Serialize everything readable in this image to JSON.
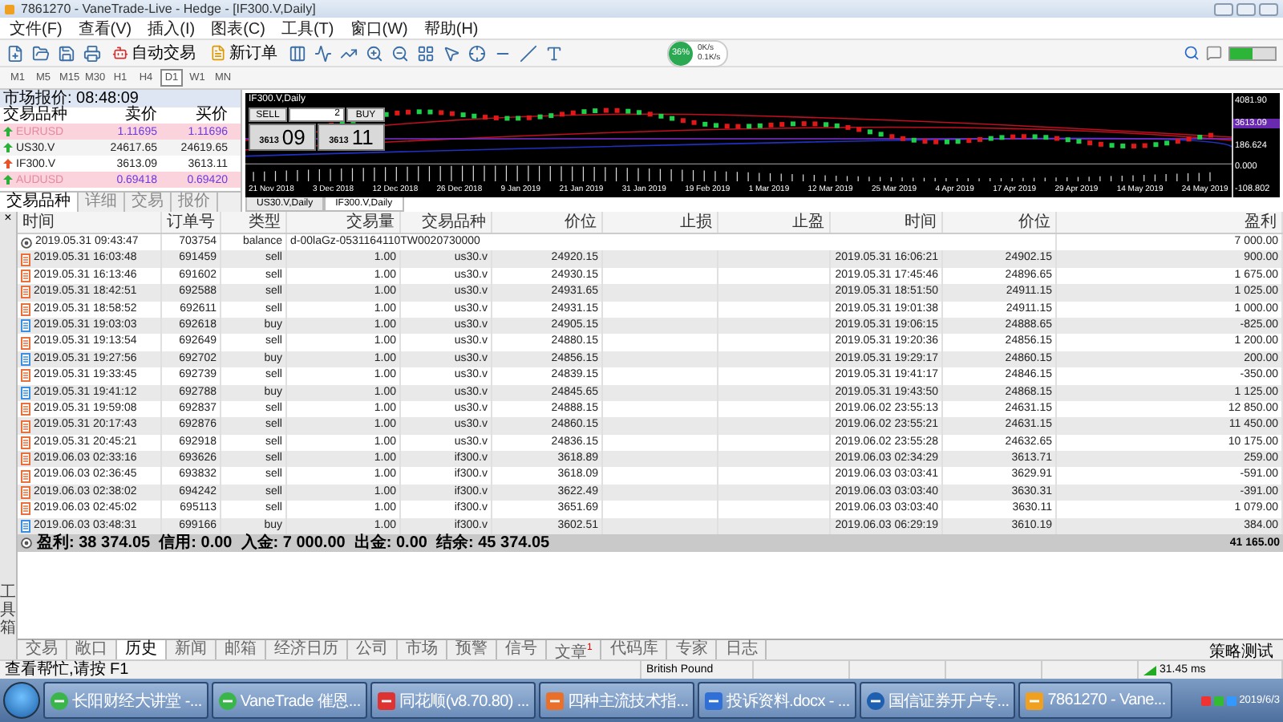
{
  "window": {
    "title": "7861270 - VaneTrade-Live - Hedge - [IF300.V,Daily]"
  },
  "menu": [
    "文件(F)",
    "查看(V)",
    "插入(I)",
    "图表(C)",
    "工具(T)",
    "窗口(W)",
    "帮助(H)"
  ],
  "toolbar": {
    "buttons": [
      "自动交易",
      "新订单"
    ],
    "network": {
      "percent": "36%",
      "upload": "0K/s",
      "download": "0.1K/s"
    }
  },
  "timeframes": [
    {
      "label": "M1",
      "selected": false
    },
    {
      "label": "M5",
      "selected": false
    },
    {
      "label": "M15",
      "selected": false
    },
    {
      "label": "M30",
      "selected": false
    },
    {
      "label": "H1",
      "selected": false
    },
    {
      "label": "H4",
      "selected": false
    },
    {
      "label": "D1",
      "selected": true
    },
    {
      "label": "W1",
      "selected": false
    },
    {
      "label": "MN",
      "selected": false
    }
  ],
  "market_watch": {
    "title": "市场报价: 08:48:09",
    "columns": [
      "交易品种",
      "卖价",
      "买价"
    ],
    "rows": [
      {
        "symbol": "EURUSD",
        "bid": "1.11695",
        "ask": "1.11696",
        "highlighted": true,
        "rising": true
      },
      {
        "symbol": "US30.V",
        "bid": "24617.65",
        "ask": "24619.65",
        "highlighted": false,
        "rising": true
      },
      {
        "symbol": "IF300.V",
        "bid": "3613.09",
        "ask": "3613.11",
        "highlighted": false,
        "rising": false
      },
      {
        "symbol": "AUDUSD",
        "bid": "0.69418",
        "ask": "0.69420",
        "highlighted": true,
        "rising": true
      }
    ],
    "tabs": [
      {
        "label": "交易品种",
        "selected": true
      },
      {
        "label": "详细",
        "selected": false
      },
      {
        "label": "交易",
        "selected": false
      },
      {
        "label": "报价",
        "selected": false
      }
    ]
  },
  "chart": {
    "title": "IF300.V,Daily",
    "sell": "SELL",
    "buy": "BUY",
    "lots": "2",
    "bid_small": "3613",
    "bid_big": "09",
    "ask_small": "3613",
    "ask_big": "11",
    "price_labels": [
      "4081.90",
      "3613.09",
      "186.624",
      "0.000",
      "-108.802"
    ],
    "dates": [
      "21 Nov 2018",
      "3 Dec 2018",
      "12 Dec 2018",
      "26 Dec 2018",
      "9 Jan 2019",
      "21 Jan 2019",
      "31 Jan 2019",
      "19 Feb 2019",
      "1 Mar 2019",
      "12 Mar 2019",
      "25 Mar 2019",
      "4 Apr 2019",
      "17 Apr 2019",
      "29 Apr 2019",
      "14 May 2019",
      "24 May 2019"
    ],
    "tabs": [
      {
        "label": "US30.V,Daily",
        "selected": false
      },
      {
        "label": "IF300.V,Daily",
        "selected": true
      }
    ]
  },
  "history": {
    "columns": [
      "时间",
      "订单号",
      "类型",
      "交易量",
      "交易品种",
      "价位",
      "止损",
      "止盈",
      "时间",
      "价位",
      "盈利"
    ],
    "rows": [
      {
        "kind": "balance",
        "time": "2019.05.31 09:43:47",
        "order": "703754",
        "type": "balance",
        "comment": "d-00laGz-0531164110TW0020730000",
        "profit": "7 000.00"
      },
      {
        "kind": "sell",
        "time": "2019.05.31 16:03:48",
        "order": "691459",
        "type": "sell",
        "volume": "1.00",
        "symbol": "us30.v",
        "price": "24920.15",
        "close_time": "2019.05.31 16:06:21",
        "close_price": "24902.15",
        "profit": "900.00"
      },
      {
        "kind": "sell",
        "time": "2019.05.31 16:13:46",
        "order": "691602",
        "type": "sell",
        "volume": "1.00",
        "symbol": "us30.v",
        "price": "24930.15",
        "close_time": "2019.05.31 17:45:46",
        "close_price": "24896.65",
        "profit": "1 675.00"
      },
      {
        "kind": "sell",
        "time": "2019.05.31 18:42:51",
        "order": "692588",
        "type": "sell",
        "volume": "1.00",
        "symbol": "us30.v",
        "price": "24931.65",
        "close_time": "2019.05.31 18:51:50",
        "close_price": "24911.15",
        "profit": "1 025.00"
      },
      {
        "kind": "sell",
        "time": "2019.05.31 18:58:52",
        "order": "692611",
        "type": "sell",
        "volume": "1.00",
        "symbol": "us30.v",
        "price": "24931.15",
        "close_time": "2019.05.31 19:01:38",
        "close_price": "24911.15",
        "profit": "1 000.00"
      },
      {
        "kind": "buy",
        "time": "2019.05.31 19:03:03",
        "order": "692618",
        "type": "buy",
        "volume": "1.00",
        "symbol": "us30.v",
        "price": "24905.15",
        "close_time": "2019.05.31 19:06:15",
        "close_price": "24888.65",
        "profit": "-825.00"
      },
      {
        "kind": "sell",
        "time": "2019.05.31 19:13:54",
        "order": "692649",
        "type": "sell",
        "volume": "1.00",
        "symbol": "us30.v",
        "price": "24880.15",
        "close_time": "2019.05.31 19:20:36",
        "close_price": "24856.15",
        "profit": "1 200.00"
      },
      {
        "kind": "buy",
        "time": "2019.05.31 19:27:56",
        "order": "692702",
        "type": "buy",
        "volume": "1.00",
        "symbol": "us30.v",
        "price": "24856.15",
        "close_time": "2019.05.31 19:29:17",
        "close_price": "24860.15",
        "profit": "200.00"
      },
      {
        "kind": "sell",
        "time": "2019.05.31 19:33:45",
        "order": "692739",
        "type": "sell",
        "volume": "1.00",
        "symbol": "us30.v",
        "price": "24839.15",
        "close_time": "2019.05.31 19:41:17",
        "close_price": "24846.15",
        "profit": "-350.00"
      },
      {
        "kind": "buy",
        "time": "2019.05.31 19:41:12",
        "order": "692788",
        "type": "buy",
        "volume": "1.00",
        "symbol": "us30.v",
        "price": "24845.65",
        "close_time": "2019.05.31 19:43:50",
        "close_price": "24868.15",
        "profit": "1 125.00"
      },
      {
        "kind": "sell",
        "time": "2019.05.31 19:59:08",
        "order": "692837",
        "type": "sell",
        "volume": "1.00",
        "symbol": "us30.v",
        "price": "24888.15",
        "close_time": "2019.06.02 23:55:13",
        "close_price": "24631.15",
        "profit": "12 850.00"
      },
      {
        "kind": "sell",
        "time": "2019.05.31 20:17:43",
        "order": "692876",
        "type": "sell",
        "volume": "1.00",
        "symbol": "us30.v",
        "price": "24860.15",
        "close_time": "2019.06.02 23:55:21",
        "close_price": "24631.15",
        "profit": "11 450.00"
      },
      {
        "kind": "sell",
        "time": "2019.05.31 20:45:21",
        "order": "692918",
        "type": "sell",
        "volume": "1.00",
        "symbol": "us30.v",
        "price": "24836.15",
        "close_time": "2019.06.02 23:55:28",
        "close_price": "24632.65",
        "profit": "10 175.00"
      },
      {
        "kind": "sell",
        "time": "2019.06.03 02:33:16",
        "order": "693626",
        "type": "sell",
        "volume": "1.00",
        "symbol": "if300.v",
        "price": "3618.89",
        "close_time": "2019.06.03 02:34:29",
        "close_price": "3613.71",
        "profit": "259.00"
      },
      {
        "kind": "sell",
        "time": "2019.06.03 02:36:45",
        "order": "693832",
        "type": "sell",
        "volume": "1.00",
        "symbol": "if300.v",
        "price": "3618.09",
        "close_time": "2019.06.03 03:03:41",
        "close_price": "3629.91",
        "profit": "-591.00"
      },
      {
        "kind": "sell",
        "time": "2019.06.03 02:38:02",
        "order": "694242",
        "type": "sell",
        "volume": "1.00",
        "symbol": "if300.v",
        "price": "3622.49",
        "close_time": "2019.06.03 03:03:40",
        "close_price": "3630.31",
        "profit": "-391.00"
      },
      {
        "kind": "sell",
        "time": "2019.06.03 02:45:02",
        "order": "695113",
        "type": "sell",
        "volume": "1.00",
        "symbol": "if300.v",
        "price": "3651.69",
        "close_time": "2019.06.03 03:03:40",
        "close_price": "3630.11",
        "profit": "1 079.00"
      },
      {
        "kind": "buy",
        "time": "2019.06.03 03:48:31",
        "order": "699166",
        "type": "buy",
        "volume": "1.00",
        "symbol": "if300.v",
        "price": "3602.51",
        "close_time": "2019.06.03 06:29:19",
        "close_price": "3610.19",
        "profit": "384.00"
      }
    ],
    "summary": {
      "text": "盈利: 38 374.05  信用: 0.00  入金: 7 000.00  出金: 0.00  结余: 45 374.05",
      "total": "41 165.00"
    }
  },
  "toolbox": {
    "close": "×",
    "label": "工具箱"
  },
  "terminal_tabs": [
    {
      "label": "交易",
      "selected": false
    },
    {
      "label": "敞口",
      "selected": false
    },
    {
      "label": "历史",
      "selected": true
    },
    {
      "label": "新闻",
      "selected": false
    },
    {
      "label": "邮箱",
      "selected": false
    },
    {
      "label": "经济日历",
      "selected": false
    },
    {
      "label": "公司",
      "selected": false
    },
    {
      "label": "市场",
      "selected": false
    },
    {
      "label": "预警",
      "selected": false
    },
    {
      "label": "信号",
      "selected": false
    },
    {
      "label": "文章",
      "selected": false,
      "badge": "1"
    },
    {
      "label": "代码库",
      "selected": false
    },
    {
      "label": "专家",
      "selected": false
    },
    {
      "label": "日志",
      "selected": false
    }
  ],
  "strategy_tester": "策略测试",
  "status_bar": {
    "help": "查看帮忙,请按 F1",
    "symbol": "British Pound",
    "ping": "31.45 ms"
  },
  "taskbar": {
    "items": [
      {
        "label": "长阳财经大讲堂 -...",
        "kind": "green"
      },
      {
        "label": "VaneTrade 催恩...",
        "kind": "green"
      },
      {
        "label": "同花顺(v8.70.80) ...",
        "kind": "cards"
      },
      {
        "label": "四种主流技术指...",
        "kind": "slides"
      },
      {
        "label": "投诉资料.docx - ...",
        "kind": "word"
      },
      {
        "label": "国信证券开户专...",
        "kind": "shield"
      },
      {
        "label": "7861270 - Vane...",
        "kind": "vt"
      }
    ],
    "date": "2019/6/3"
  }
}
